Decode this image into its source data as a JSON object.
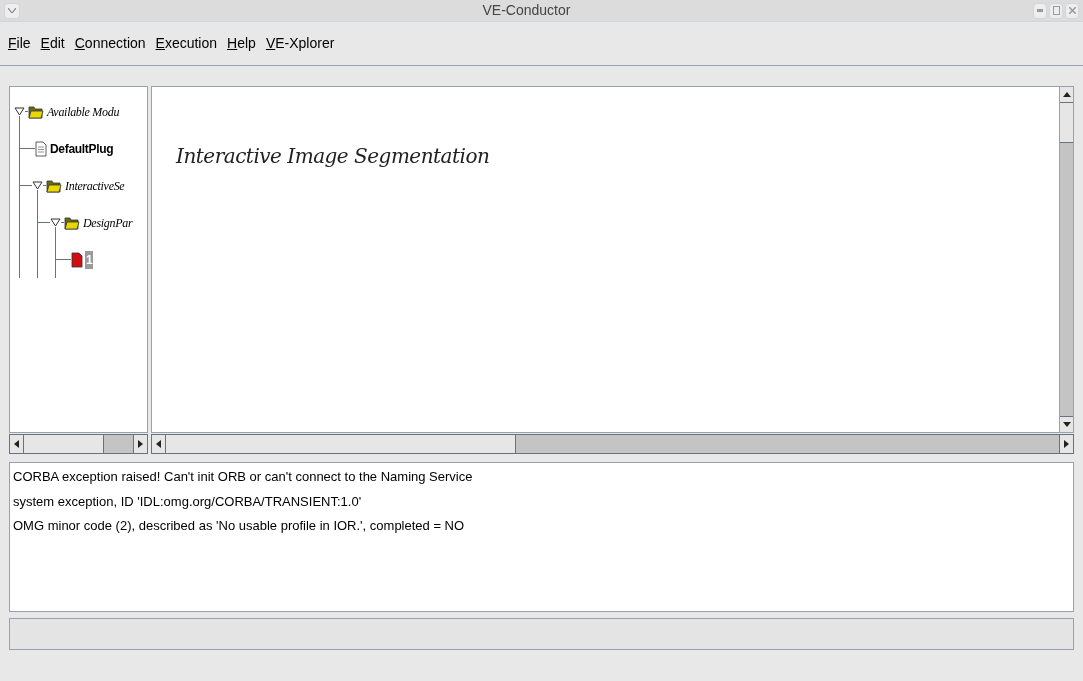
{
  "window": {
    "title": "VE-Conductor"
  },
  "menu": [
    {
      "label": "File"
    },
    {
      "label": "Edit"
    },
    {
      "label": "Connection"
    },
    {
      "label": "Execution"
    },
    {
      "label": "Help"
    },
    {
      "label": "VE-Xplorer"
    }
  ],
  "tree": [
    {
      "label": "Available Modu",
      "kind": "folder",
      "expanded": true,
      "selected": false,
      "children": [
        {
          "label": "DefaultPlug",
          "kind": "document",
          "selected": false
        },
        {
          "label": "InteractiveSe",
          "kind": "folder",
          "expanded": true,
          "selected": false,
          "children": [
            {
              "label": "DesignPar",
              "kind": "folder",
              "expanded": true,
              "selected": false,
              "children": [
                {
                  "label": "1",
                  "kind": "red-document",
                  "selected": true
                }
              ]
            }
          ]
        }
      ]
    }
  ],
  "canvas": {
    "title": "Interactive Image Segmentation"
  },
  "log": [
    "CORBA exception raised! Can't init ORB or can't connect to the Naming Service",
    "system exception, ID 'IDL:omg.org/CORBA/TRANSIENT:1.0'",
    "OMG minor code (2), described as 'No usable profile in IOR.', completed = NO"
  ]
}
